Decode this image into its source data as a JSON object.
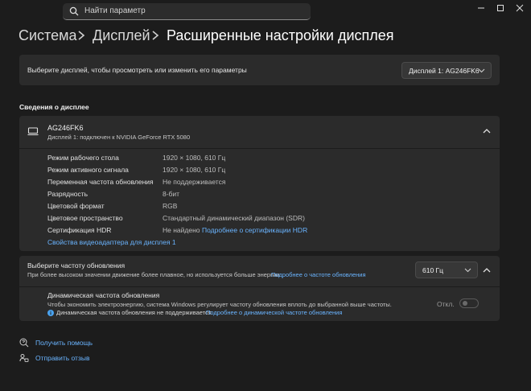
{
  "search": {
    "placeholder": "Найти параметр"
  },
  "breadcrumb": {
    "item1": "Система",
    "item2": "Дисплей",
    "current": "Расширенные настройки дисплея"
  },
  "select_display": {
    "label": "Выберите дисплей, чтобы просмотреть или изменить его параметры",
    "value": "Дисплей 1: AG246FK6"
  },
  "section_title": "Сведения о дисплее",
  "display_info": {
    "name": "AG246FK6",
    "subtitle": "Дисплей 1: подключен к NVIDIA GeForce RTX 5080",
    "rows": [
      {
        "label": "Режим рабочего стола",
        "value": "1920 × 1080, 610 Гц"
      },
      {
        "label": "Режим активного сигнала",
        "value": "1920 × 1080, 610 Гц"
      },
      {
        "label": "Переменная частота обновления",
        "value": "Не поддерживается"
      },
      {
        "label": "Разрядность",
        "value": "8-бит"
      },
      {
        "label": "Цветовой формат",
        "value": "RGB"
      },
      {
        "label": "Цветовое пространство",
        "value": "Стандартный динамический диапазон (SDR)"
      },
      {
        "label": "Сертификация HDR",
        "value": "Не найдено",
        "link": "Подробнее о сертификации HDR"
      }
    ],
    "adapter_link": "Свойства видеоадаптера для дисплея 1"
  },
  "refresh": {
    "title": "Выберите частоту обновления",
    "desc": "При более высоком значении движение более плавное, но используется больше энергии",
    "link": "Подробнее о частоте обновления",
    "value": "610 Гц"
  },
  "dynamic": {
    "title": "Динамическая частота обновления",
    "desc": "Чтобы экономить электроэнергию, система Windows регулирует частоту обновления вплоть до выбранной выше частоты.",
    "note": "Динамическая частота обновления не поддерживается",
    "link": "Подробнее о динамической частоте обновления",
    "toggle_label": "Откл."
  },
  "footer": {
    "help": "Получить помощь",
    "feedback": "Отправить отзыв"
  },
  "colors": {
    "background": "#1c1c1c",
    "card": "#2b2b2b",
    "link": "#6ab4ff",
    "info_icon": "#4aa3f0"
  }
}
